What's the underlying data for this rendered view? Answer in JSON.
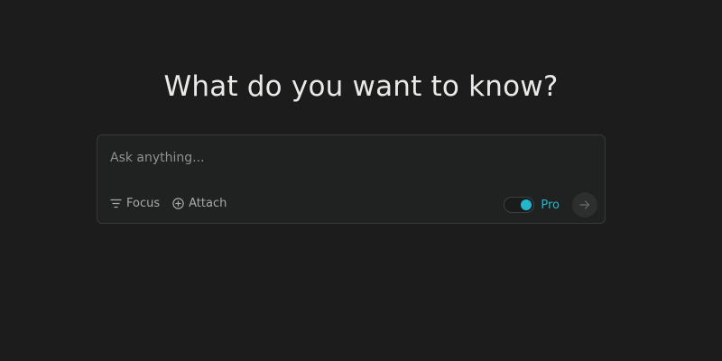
{
  "hero": {
    "headline": "What do you want to know?"
  },
  "ask_box": {
    "placeholder": "Ask anything...",
    "value": ""
  },
  "toolbar": {
    "focus_label": "Focus",
    "focus_icon": "filter-lines-icon",
    "attach_label": "Attach",
    "attach_icon": "plus-circle-icon",
    "pro_label": "Pro",
    "pro_enabled": true,
    "submit_icon": "arrow-right-icon"
  },
  "colors": {
    "background": "#1c1c1c",
    "box_background": "#202222",
    "accent": "#20b8cd",
    "text_primary": "#e9e9e6",
    "text_muted": "#a8aaaa"
  }
}
